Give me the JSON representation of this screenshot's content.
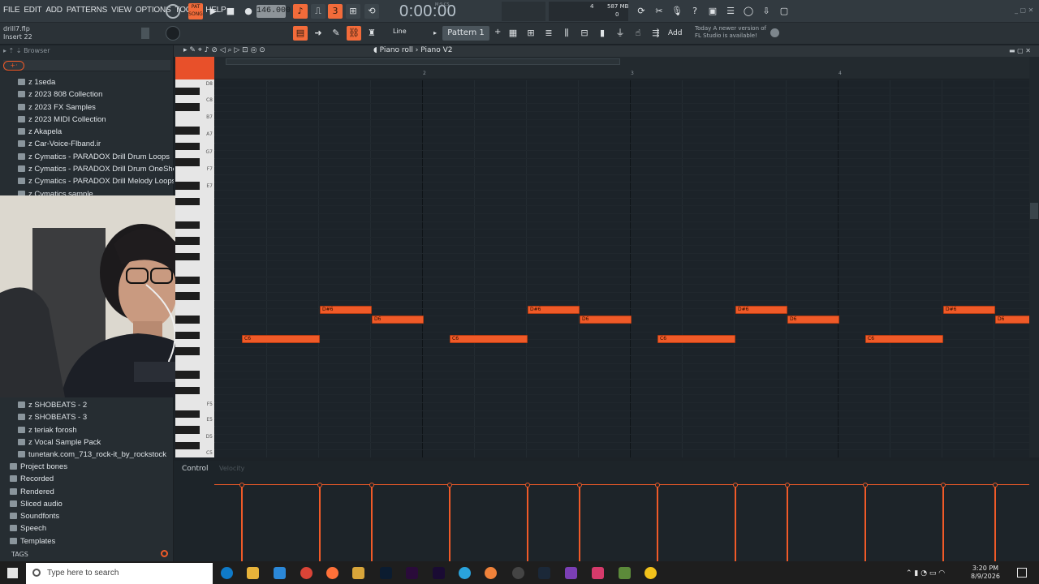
{
  "menu": [
    "FILE",
    "EDIT",
    "ADD",
    "PATTERNS",
    "VIEW",
    "OPTIONS",
    "TOOLS",
    "HELP"
  ],
  "transport": {
    "tempo": "146.000",
    "time": "0:00:00",
    "time_label": "M:S:CS",
    "pat_label": "PAT",
    "song_label": "SONG"
  },
  "cpu": {
    "mem": "587 MB",
    "voices": "4",
    "zero": "0"
  },
  "file": {
    "name": "drill7.flp",
    "insert": "Insert 22"
  },
  "pattern": {
    "name": "Pattern 1",
    "tool": "Line",
    "add": "Add"
  },
  "news": {
    "line1": "Today  A newer version of",
    "line2": "FL Studio is available!"
  },
  "browser": {
    "title": "Browser",
    "top_items": [
      "1seda",
      "2023 808 Collection",
      "2023 FX Samples",
      "2023 MIDI Collection",
      "Akapela",
      "Car-Voice-Flband.ir",
      "Cymatics - PARADOX Drill Drum Loops",
      "Cymatics - PARADOX Drill Drum OneShots",
      "Cymatics - PARADOX Drill Melody Loops",
      "Cymatics sample"
    ],
    "bottom_items": [
      "SHOBEATS - 2",
      "SHOBEATS - 3",
      "teriak forosh",
      "Vocal Sample Pack",
      "tunetank.com_713_rock-it_by_rockstock"
    ],
    "folders": [
      "Project bones",
      "Recorded",
      "Rendered",
      "Sliced audio",
      "Soundfonts",
      "Speech",
      "Templates"
    ],
    "tags": "TAGS"
  },
  "piano_roll": {
    "title": "Piano roll",
    "subtitle": "Piano V2",
    "ruler": [
      "2",
      "3",
      "4"
    ],
    "key_labels": [
      "D8",
      "C8",
      "B7",
      "A7",
      "G7",
      "F7",
      "E7",
      "F5",
      "E5",
      "D5",
      "C5"
    ],
    "control": "Control",
    "control_param": "Velocity"
  },
  "notes": [
    {
      "pitch": "D#6",
      "start": 1.5,
      "len": 1.0
    },
    {
      "pitch": "D6",
      "start": 2.5,
      "len": 1.0
    },
    {
      "pitch": "C6",
      "start": 0.0,
      "len": 1.5
    },
    {
      "pitch": "D#6",
      "start": 5.5,
      "len": 1.0
    },
    {
      "pitch": "D6",
      "start": 6.5,
      "len": 1.0
    },
    {
      "pitch": "C6",
      "start": 4.0,
      "len": 1.5
    },
    {
      "pitch": "D#6",
      "start": 9.5,
      "len": 1.0
    },
    {
      "pitch": "D6",
      "start": 10.5,
      "len": 1.0
    },
    {
      "pitch": "C6",
      "start": 8.0,
      "len": 1.5
    },
    {
      "pitch": "D#6",
      "start": 13.5,
      "len": 1.0
    },
    {
      "pitch": "D6",
      "start": 14.5,
      "len": 1.0
    },
    {
      "pitch": "C6",
      "start": 12.0,
      "len": 1.5
    }
  ],
  "taskbar": {
    "search": "Type here to search",
    "time": "3:20 PM",
    "date": "8/9/2026"
  },
  "colors": {
    "accent": "#f05a28",
    "bg": "#1c2329",
    "panel": "#262d32"
  }
}
